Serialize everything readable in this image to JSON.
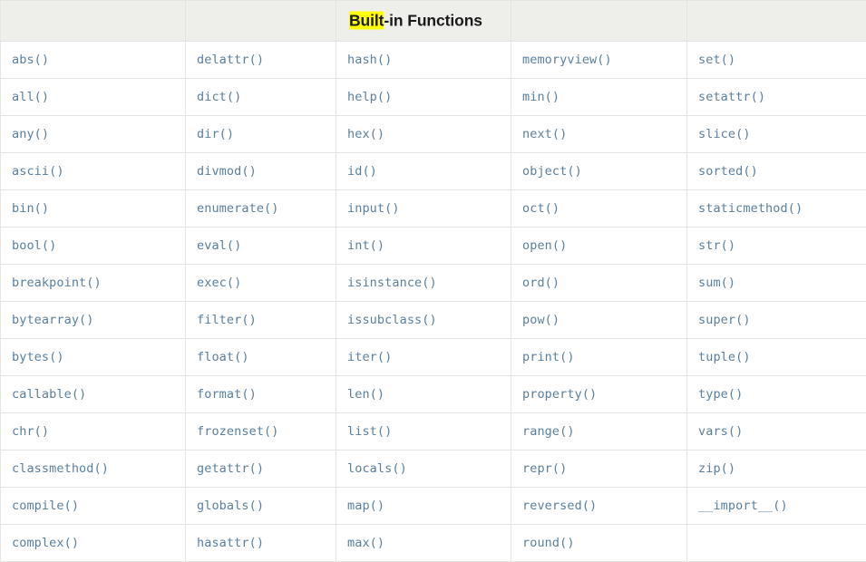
{
  "header": {
    "title_highlight": "Built",
    "title_rest": "-in Functions",
    "title_full": "Built-in Functions",
    "highlight_color": "#ffff00",
    "background_color": "#eeeeea",
    "text_color": "#1a1a1a"
  },
  "style": {
    "link_color": "#5a7f9e",
    "border_color": "#eaeae6",
    "cell_background": "#ffffff"
  },
  "table": {
    "column_count": 5,
    "row_count": 14,
    "rows": [
      [
        "abs()",
        "delattr()",
        "hash()",
        "memoryview()",
        "set()"
      ],
      [
        "all()",
        "dict()",
        "help()",
        "min()",
        "setattr()"
      ],
      [
        "any()",
        "dir()",
        "hex()",
        "next()",
        "slice()"
      ],
      [
        "ascii()",
        "divmod()",
        "id()",
        "object()",
        "sorted()"
      ],
      [
        "bin()",
        "enumerate()",
        "input()",
        "oct()",
        "staticmethod()"
      ],
      [
        "bool()",
        "eval()",
        "int()",
        "open()",
        "str()"
      ],
      [
        "breakpoint()",
        "exec()",
        "isinstance()",
        "ord()",
        "sum()"
      ],
      [
        "bytearray()",
        "filter()",
        "issubclass()",
        "pow()",
        "super()"
      ],
      [
        "bytes()",
        "float()",
        "iter()",
        "print()",
        "tuple()"
      ],
      [
        "callable()",
        "format()",
        "len()",
        "property()",
        "type()"
      ],
      [
        "chr()",
        "frozenset()",
        "list()",
        "range()",
        "vars()"
      ],
      [
        "classmethod()",
        "getattr()",
        "locals()",
        "repr()",
        "zip()"
      ],
      [
        "compile()",
        "globals()",
        "map()",
        "reversed()",
        "__import__()"
      ],
      [
        "complex()",
        "hasattr()",
        "max()",
        "round()",
        ""
      ]
    ]
  }
}
